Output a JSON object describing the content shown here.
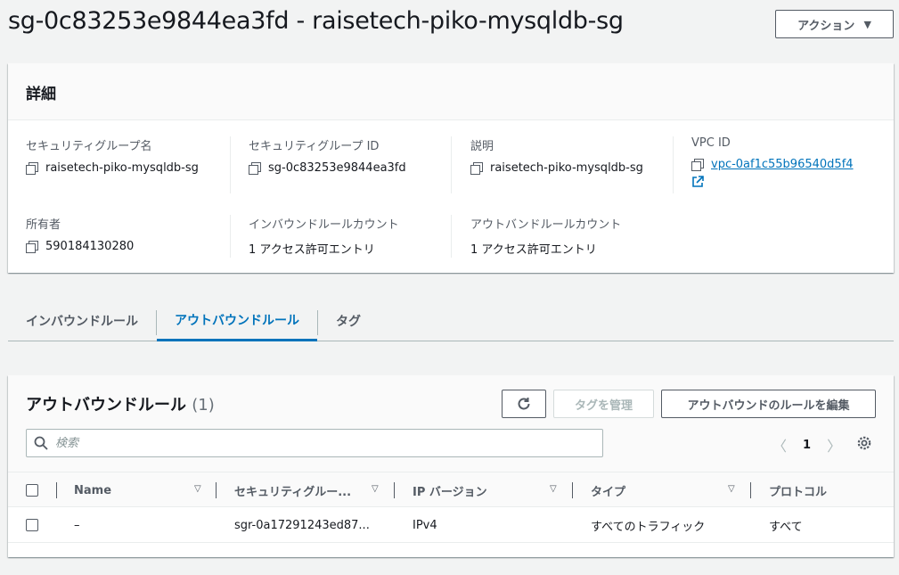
{
  "page": {
    "title": "sg-0c83253e9844ea3fd - raisetech-piko-mysqldb-sg",
    "action_label": "アクション"
  },
  "details": {
    "heading": "詳細",
    "sg_name_label": "セキュリティグループ名",
    "sg_name_value": "raisetech-piko-mysqldb-sg",
    "sg_id_label": "セキュリティグループ ID",
    "sg_id_value": "sg-0c83253e9844ea3fd",
    "description_label": "説明",
    "description_value": "raisetech-piko-mysqldb-sg",
    "vpc_id_label": "VPC ID",
    "vpc_id_value": "vpc-0af1c55b96540d5f4",
    "owner_label": "所有者",
    "owner_value": "590184130280",
    "inbound_count_label": "インバウンドルールカウント",
    "inbound_count_value": "1 アクセス許可エントリ",
    "outbound_count_label": "アウトバンドルールカウント",
    "outbound_count_value": "1 アクセス許可エントリ"
  },
  "tabs": [
    {
      "label": "インバウンドルール",
      "active": false
    },
    {
      "label": "アウトバウンドルール",
      "active": true
    },
    {
      "label": "タグ",
      "active": false
    }
  ],
  "rules": {
    "title": "アウトバウンドルール",
    "count": "(1)",
    "refresh_icon": "refresh-icon",
    "manage_tags_label": "タグを管理",
    "edit_rules_label": "アウトバウンドのルールを編集",
    "search_placeholder": "検索",
    "page_number": "1",
    "columns": [
      "Name",
      "セキュリティグルー...",
      "IP バージョン",
      "タイプ",
      "プロトコル"
    ],
    "rows": [
      {
        "name": "–",
        "rule_id": "sgr-0a17291243ed87...",
        "ip_version": "IPv4",
        "type": "すべてのトラフィック",
        "protocol": "すべて"
      }
    ]
  },
  "colors": {
    "accent": "#0073bb",
    "border": "#545b64",
    "background": "#f2f3f3"
  }
}
